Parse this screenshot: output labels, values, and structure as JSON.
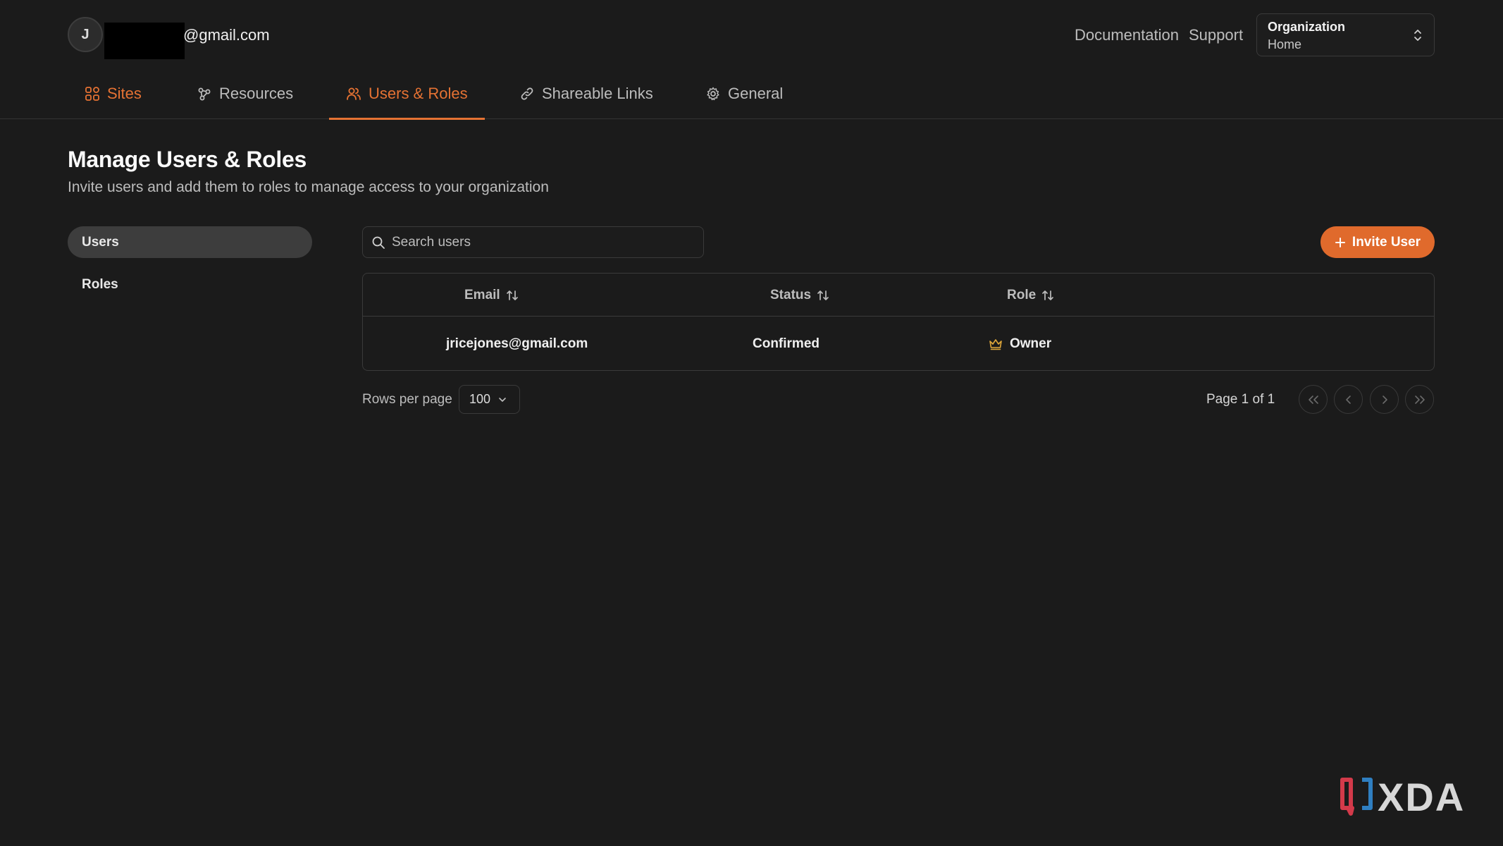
{
  "account": {
    "avatar_initial": "J",
    "email_suffix": "@gmail.com"
  },
  "header": {
    "documentation_label": "Documentation",
    "support_label": "Support",
    "org_selector": {
      "label": "Organization",
      "value": "Home"
    }
  },
  "tabs": [
    {
      "label": "Sites",
      "icon": "sites-icon"
    },
    {
      "label": "Resources",
      "icon": "resources-icon"
    },
    {
      "label": "Users & Roles",
      "icon": "users-icon",
      "active": true
    },
    {
      "label": "Shareable Links",
      "icon": "link-icon"
    },
    {
      "label": "General",
      "icon": "gear-icon"
    }
  ],
  "page": {
    "title": "Manage Users & Roles",
    "subtitle": "Invite users and add them to roles to manage access to your organization"
  },
  "sidenav": {
    "items": [
      {
        "label": "Users",
        "active": true
      },
      {
        "label": "Roles",
        "active": false
      }
    ]
  },
  "search": {
    "placeholder": "Search users",
    "value": ""
  },
  "invite_button": {
    "label": "Invite User"
  },
  "table": {
    "columns": [
      "Email",
      "Status",
      "Role"
    ],
    "rows": [
      {
        "email": "jricejones@gmail.com",
        "status": "Confirmed",
        "role": "Owner",
        "role_icon": "crown-icon"
      }
    ]
  },
  "pagination": {
    "rows_per_page_label": "Rows per page",
    "rows_per_page_value": "100",
    "page_info": "Page 1 of 1"
  },
  "watermark": {
    "text": "XDA"
  },
  "colors": {
    "accent": "#e06a2c",
    "tab_accent": "#e57233",
    "background": "#1b1b1b"
  }
}
